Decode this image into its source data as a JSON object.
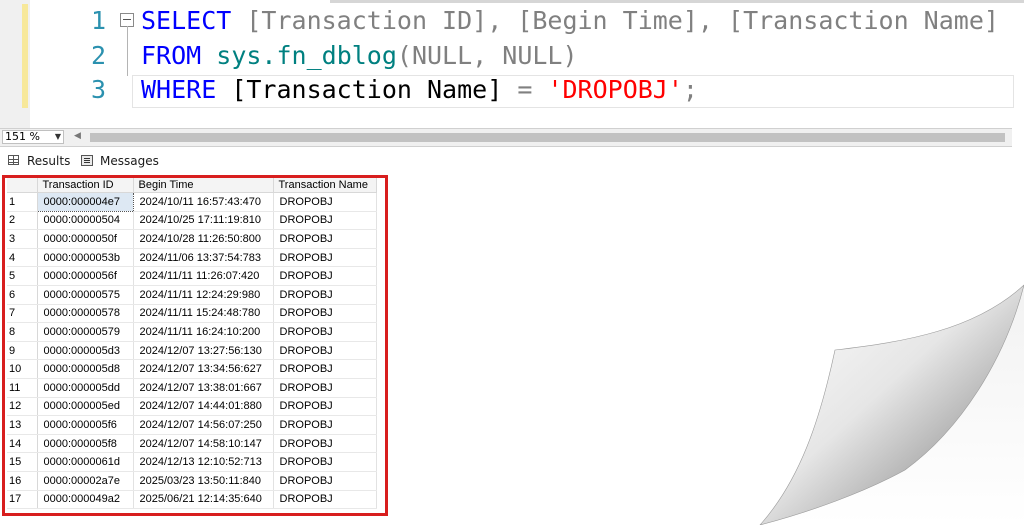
{
  "editor": {
    "lines": [
      {
        "num": "1",
        "code": "SELECT [Transaction ID], [Begin Time], [Transaction Name]"
      },
      {
        "num": "2",
        "code": "FROM sys.fn_dblog(NULL, NULL)"
      },
      {
        "num": "3",
        "code": "WHERE [Transaction Name] = 'DROPOBJ';"
      }
    ],
    "tokens": {
      "l1_select": "SELECT",
      "l1_cols": "[Transaction ID], [Begin Time], [Transaction Name]",
      "l2_from": "FROM",
      "l2_fn": "sys.fn_dblog",
      "l2_args": "(NULL, NULL)",
      "l3_where": "WHERE",
      "l3_col": "[Transaction Name]",
      "l3_eq": "=",
      "l3_str": "'DROPOBJ'",
      "l3_semi": ";"
    }
  },
  "zoom": {
    "level": "151 %"
  },
  "tabs": {
    "results": "Results",
    "messages": "Messages"
  },
  "grid": {
    "columns": [
      "Transaction ID",
      "Begin Time",
      "Transaction Name"
    ],
    "rows": [
      [
        "1",
        "0000:000004e7",
        "2024/10/11 16:57:43:470",
        "DROPOBJ"
      ],
      [
        "2",
        "0000:00000504",
        "2024/10/25 17:11:19:810",
        "DROPOBJ"
      ],
      [
        "3",
        "0000:0000050f",
        "2024/10/28 11:26:50:800",
        "DROPOBJ"
      ],
      [
        "4",
        "0000:0000053b",
        "2024/11/06 13:37:54:783",
        "DROPOBJ"
      ],
      [
        "5",
        "0000:0000056f",
        "2024/11/11 11:26:07:420",
        "DROPOBJ"
      ],
      [
        "6",
        "0000:00000575",
        "2024/11/11 12:24:29:980",
        "DROPOBJ"
      ],
      [
        "7",
        "0000:00000578",
        "2024/11/11 15:24:48:780",
        "DROPOBJ"
      ],
      [
        "8",
        "0000:00000579",
        "2024/11/11 16:24:10:200",
        "DROPOBJ"
      ],
      [
        "9",
        "0000:000005d3",
        "2024/12/07 13:27:56:130",
        "DROPOBJ"
      ],
      [
        "10",
        "0000:000005d8",
        "2024/12/07 13:34:56:627",
        "DROPOBJ"
      ],
      [
        "11",
        "0000:000005dd",
        "2024/12/07 13:38:01:667",
        "DROPOBJ"
      ],
      [
        "12",
        "0000:000005ed",
        "2024/12/07 14:44:01:880",
        "DROPOBJ"
      ],
      [
        "13",
        "0000:000005f6",
        "2024/12/07 14:56:07:250",
        "DROPOBJ"
      ],
      [
        "14",
        "0000:000005f8",
        "2024/12/07 14:58:10:147",
        "DROPOBJ"
      ],
      [
        "15",
        "0000:0000061d",
        "2024/12/13 12:10:52:713",
        "DROPOBJ"
      ],
      [
        "16",
        "0000:00002a7e",
        "2025/03/23 13:50:11:840",
        "DROPOBJ"
      ],
      [
        "17",
        "0000:000049a2",
        "2025/06/21 12:14:35:640",
        "DROPOBJ"
      ]
    ]
  },
  "colors": {
    "keyword": "#0000ff",
    "function": "#008080",
    "string": "#ff0000",
    "punctuation": "#808080",
    "line_number": "#2b91af",
    "highlight_box": "#d81e1e"
  }
}
